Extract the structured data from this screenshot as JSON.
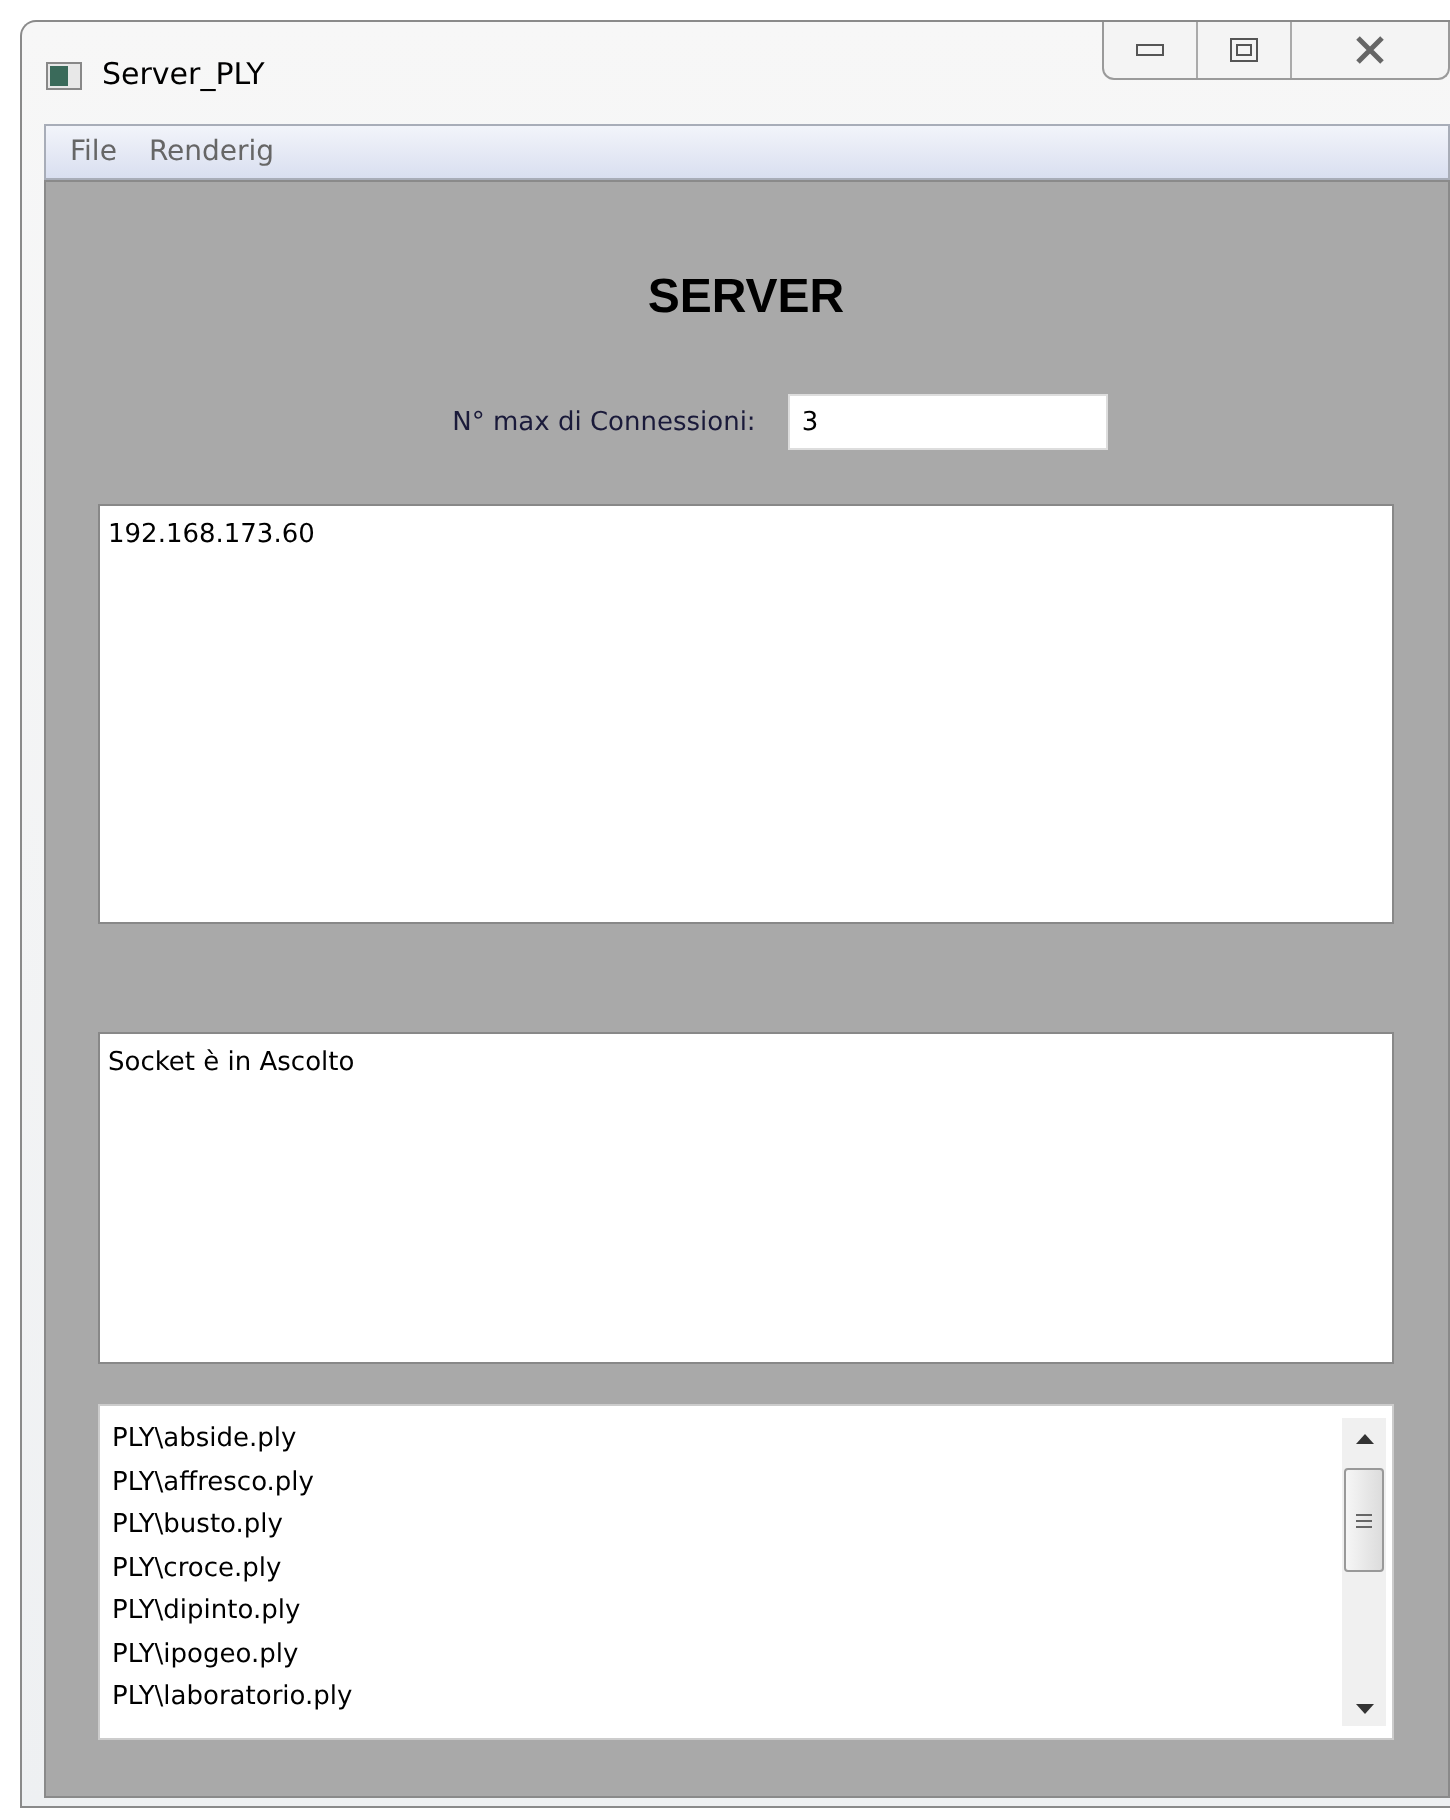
{
  "window": {
    "title": "Server_PLY"
  },
  "menu": [
    "File",
    "Renderig"
  ],
  "heading": "SERVER",
  "max_connections": {
    "label": "N° max di Connessioni:",
    "value": "3"
  },
  "clients_box": {
    "lines": [
      "192.168.173.60"
    ]
  },
  "log_box": {
    "lines": [
      "Socket è in Ascolto"
    ]
  },
  "file_list": {
    "items": [
      "PLY\\abside.ply",
      "PLY\\affresco.ply",
      "PLY\\busto.ply",
      "PLY\\croce.ply",
      "PLY\\dipinto.ply",
      "PLY\\ipogeo.ply",
      "PLY\\laboratorio.ply"
    ]
  }
}
